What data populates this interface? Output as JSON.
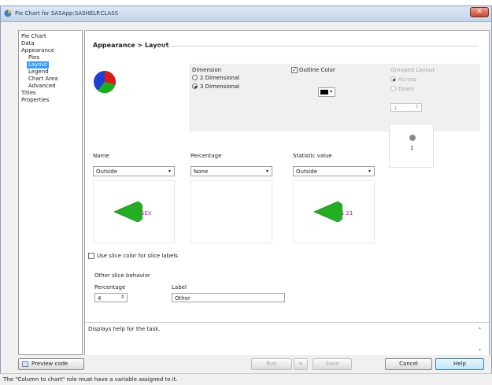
{
  "window": {
    "title": "Pie Chart for SASApp:SASHELP.CLASS"
  },
  "nav": {
    "items": [
      {
        "label": "Pie Chart",
        "indent": 0
      },
      {
        "label": "Data",
        "indent": 0
      },
      {
        "label": "Appearance",
        "indent": 0
      },
      {
        "label": "Pies",
        "indent": 1
      },
      {
        "label": "Layout",
        "indent": 1,
        "selected": true
      },
      {
        "label": "Legend",
        "indent": 1
      },
      {
        "label": "Chart Area",
        "indent": 1
      },
      {
        "label": "Advanced",
        "indent": 1
      },
      {
        "label": "Titles",
        "indent": 0
      },
      {
        "label": "Properties",
        "indent": 0
      }
    ]
  },
  "main": {
    "title": "Appearance > Layout",
    "dimension": {
      "label": "Dimension",
      "option_2d": "2 Dimensional",
      "option_3d": "3 Dimensional",
      "selected": "3 Dimensional"
    },
    "outline": {
      "label": "Outline Color",
      "checked": true,
      "color": "#000000"
    },
    "grouped": {
      "label": "Grouped Layout",
      "option_across": "Across",
      "option_down": "Down",
      "spin_value": "1",
      "preview_number": "1"
    },
    "name_section": {
      "label": "Name",
      "value": "Outside",
      "preview_text": "SEX"
    },
    "percentage_section": {
      "label": "Percentage",
      "value": "None"
    },
    "statistic_section": {
      "label": "Statistic value",
      "value": "Outside",
      "preview_text": "1.21"
    },
    "slice_color_checkbox": "Use slice color for slice labels",
    "other_slice": {
      "group_label": "Other slice behavior",
      "percentage_label": "Percentage",
      "percentage_value": "4",
      "label_label": "Label",
      "label_value": "Other"
    },
    "help_text": "Displays help for the task."
  },
  "buttons": {
    "preview": "Preview code",
    "run": "Run",
    "save": "Save",
    "cancel": "Cancel",
    "help": "Help"
  },
  "status": {
    "text": "The \"Column to chart\" role must have a variable assigned to it."
  },
  "colors": {
    "selection": "#3399ff",
    "preview_green": "#22b022",
    "preview_label": "#c020c0"
  }
}
